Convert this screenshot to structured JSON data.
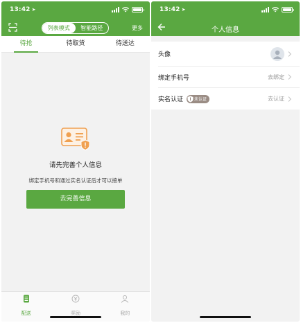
{
  "colors": {
    "brand": "#5aa841",
    "warning_orange": "#f0a050",
    "badge_gray": "#9a8c84"
  },
  "status_bar": {
    "time": "13:42",
    "location_glyph": "➤"
  },
  "left_screen": {
    "nav": {
      "scan_icon": "scan-icon",
      "segments": [
        "列表模式",
        "智能路径"
      ],
      "active_segment": "列表模式",
      "more_label": "更多"
    },
    "tabs": [
      "待抢",
      "待取货",
      "待送达"
    ],
    "active_tab": "待抢",
    "empty_state": {
      "icon": "id-card-warning-icon",
      "title": "请先完善个人信息",
      "description": "绑定手机号和通过实名认证后才可以接单",
      "button_label": "去完善信息"
    },
    "bottom_nav": [
      {
        "label": "配送",
        "icon": "delivery-list-icon",
        "active": true
      },
      {
        "label": "奖励",
        "icon": "reward-coin-icon",
        "active": false
      },
      {
        "label": "我的",
        "icon": "profile-icon",
        "active": false
      }
    ]
  },
  "right_screen": {
    "nav": {
      "back_icon": "back-arrow-icon",
      "title": "个人信息"
    },
    "rows": [
      {
        "label": "头像",
        "value": ""
      },
      {
        "label": "绑定手机号",
        "value": "去绑定"
      },
      {
        "label": "实名认证",
        "value": "去认证",
        "badge": "未认证"
      }
    ]
  }
}
